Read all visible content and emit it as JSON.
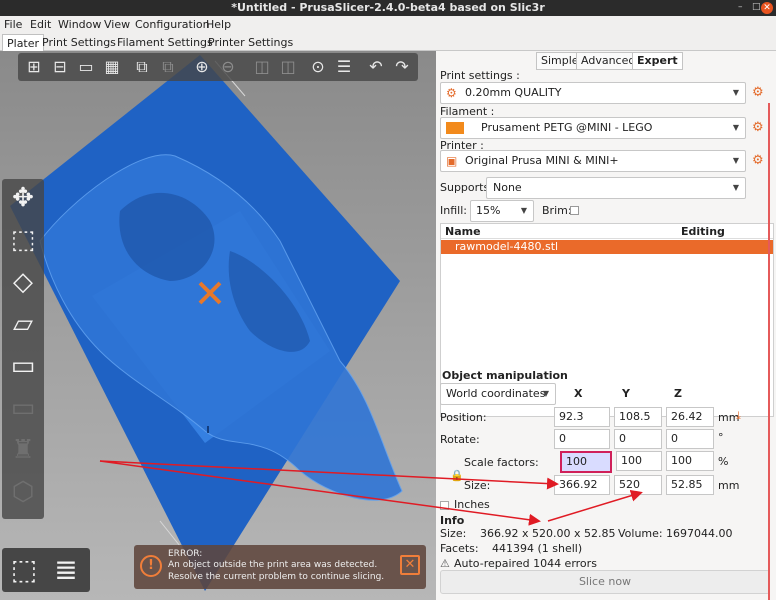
{
  "window": {
    "title": "*Untitled - PrusaSlicer-2.4.0-beta4 based on Slic3r",
    "minimize": "–",
    "maximize": "□",
    "close": "✕"
  },
  "menu": [
    "File",
    "Edit",
    "Window",
    "View",
    "Configuration",
    "Help"
  ],
  "tabs": [
    "Plater",
    "Print Settings",
    "Filament Settings",
    "Printer Settings"
  ],
  "toolbar_icons": [
    "add-icon",
    "delete-icon",
    "delete-all-icon",
    "arrange-icon",
    "copy-icon",
    "paste-icon",
    "add-instance-icon",
    "remove-instance-icon",
    "split-objects-icon",
    "split-parts-icon",
    "search-icon",
    "layers-editing-icon",
    "undo-icon",
    "redo-icon"
  ],
  "left_tools": [
    "move-icon",
    "scale-icon",
    "rotate-icon",
    "place-on-face-icon",
    "cut-icon",
    "paint-supports-icon",
    "seam-painting-icon",
    "mmu-segmentation-icon"
  ],
  "modes": {
    "simple": "Simple",
    "advanced": "Advanced",
    "expert": "Expert"
  },
  "print_settings": {
    "label": "Print settings :",
    "value": "0.20mm QUALITY"
  },
  "filament": {
    "label": "Filament :",
    "value": "Prusament PETG @MINI - LEGO",
    "color": "#f28a1c"
  },
  "printer": {
    "label": "Printer :",
    "value": "Original Prusa MINI & MINI+"
  },
  "supports": {
    "label": "Supports:",
    "value": "None"
  },
  "infill": {
    "label": "Infill:",
    "value": "15%"
  },
  "brim": {
    "label": "Brim:"
  },
  "object_list": {
    "col_name": "Name",
    "col_editing": "Editing",
    "rows": [
      {
        "name": "rawmodel-4480.stl"
      }
    ]
  },
  "manipulation": {
    "title": "Object manipulation",
    "coords": "World coordinates",
    "axes": [
      "X",
      "Y",
      "Z"
    ],
    "position_label": "Position:",
    "position": [
      "92.3",
      "108.5",
      "26.42"
    ],
    "position_unit": "mm",
    "rotate_label": "Rotate:",
    "rotate": [
      "0",
      "0",
      "0"
    ],
    "rotate_unit": "°",
    "scale_label": "Scale factors:",
    "scale": [
      "100",
      "100",
      "100"
    ],
    "scale_unit": "%",
    "size_label": "Size:",
    "size": [
      "366.92",
      "520",
      "52.85"
    ],
    "size_unit": "mm",
    "inches_label": "Inches"
  },
  "info": {
    "title": "Info",
    "size_label": "Size:",
    "size_value": "366.92 x 520.00 x 52.85",
    "volume_label": "Volume:",
    "volume_value": "1697044.00",
    "facets_label": "Facets:",
    "facets_value": "441394 (1 shell)",
    "repaired": "Auto-repaired 1044 errors"
  },
  "slice_button": "Slice now",
  "error": {
    "title": "ERROR:",
    "line1": "An object outside the print area was detected.",
    "line2": "Resolve the current problem to continue slicing."
  },
  "colors": {
    "accent": "#ea6a2a",
    "bed": "#1f62c4",
    "error_border": "#d0205a"
  }
}
